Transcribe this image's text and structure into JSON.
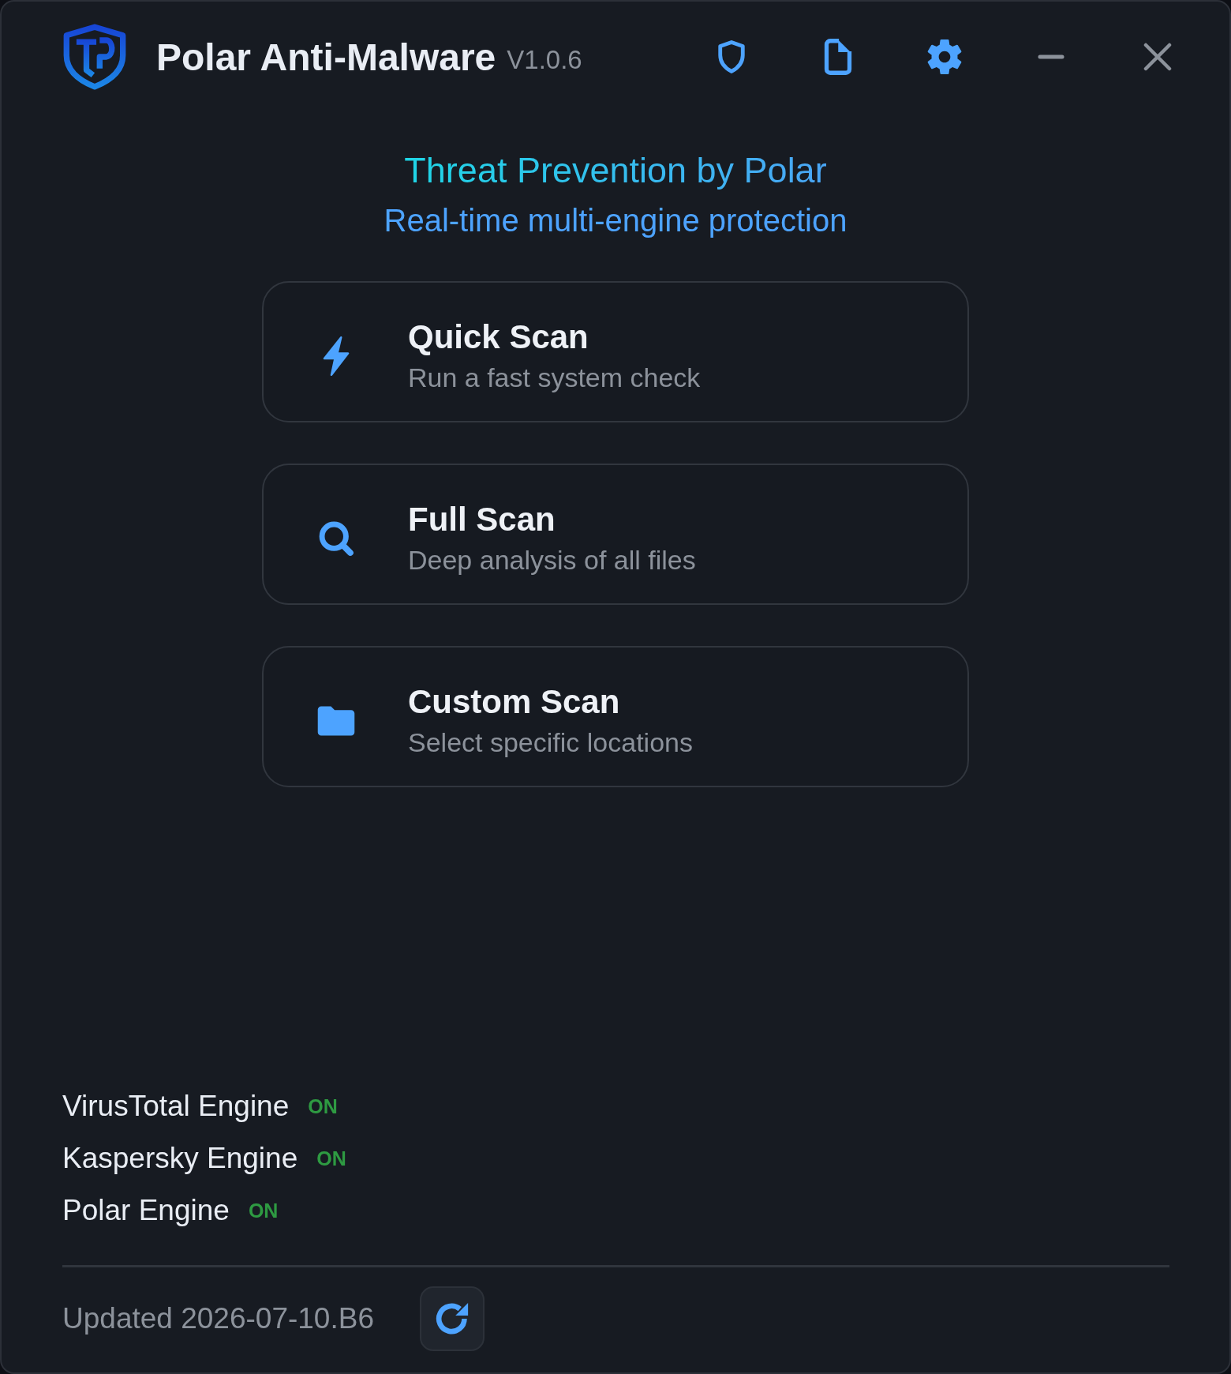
{
  "app": {
    "title": "Polar Anti-Malware",
    "version": "V1.0.6"
  },
  "hero": {
    "title": "Threat Prevention by Polar",
    "subtitle": "Real-time multi-engine protection"
  },
  "scan_options": [
    {
      "kind": "quick",
      "title": "Quick Scan",
      "description": "Run a fast system check"
    },
    {
      "kind": "full",
      "title": "Full Scan",
      "description": "Deep analysis of all files"
    },
    {
      "kind": "custom",
      "title": "Custom Scan",
      "description": "Select specific locations"
    }
  ],
  "engines": [
    {
      "name": "VirusTotal Engine",
      "status": "ON",
      "on": true
    },
    {
      "name": "Kaspersky Engine",
      "status": "ON",
      "on": true
    },
    {
      "name": "Polar Engine",
      "status": "ON",
      "on": true
    }
  ],
  "footer": {
    "updated": "Updated 2026-07-10.B6"
  }
}
